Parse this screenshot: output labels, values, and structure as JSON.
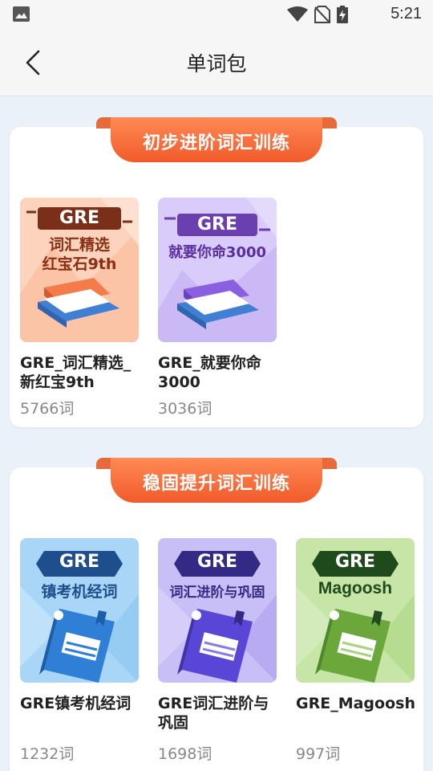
{
  "status_bar": {
    "time": "5:21"
  },
  "nav": {
    "title": "单词包"
  },
  "sections": [
    {
      "title": "初步进阶词汇训练",
      "books": [
        {
          "badge": "GRE",
          "cover_line1": "词汇精选",
          "cover_line2": "红宝石9th",
          "name": "GRE_词汇精选_新红宝9th",
          "count": "5766词"
        },
        {
          "badge": "GRE",
          "cover_line1": "就要你命3000",
          "cover_line2": "",
          "name": "GRE_就要你命3000",
          "count": "3036词"
        }
      ]
    },
    {
      "title": "稳固提升词汇训练",
      "books": [
        {
          "badge": "GRE",
          "cover_line1": "镇考机经词",
          "name": "GRE镇考机经词",
          "count": "1232词"
        },
        {
          "badge": "GRE",
          "cover_line1": "词汇进阶与巩固",
          "name": "GRE词汇进阶与巩固",
          "count": "1698词"
        },
        {
          "badge": "GRE",
          "cover_line1": "Magoosh",
          "name": "GRE_Magoosh",
          "count": "997词"
        }
      ]
    }
  ],
  "colors": {
    "ribbon": "#f15a2a",
    "cover_orange": "#fcd4bd",
    "cover_purple": "#d9ccfa",
    "cover_blue": "#a9d6f7",
    "cover_green": "#c6e5a7"
  }
}
